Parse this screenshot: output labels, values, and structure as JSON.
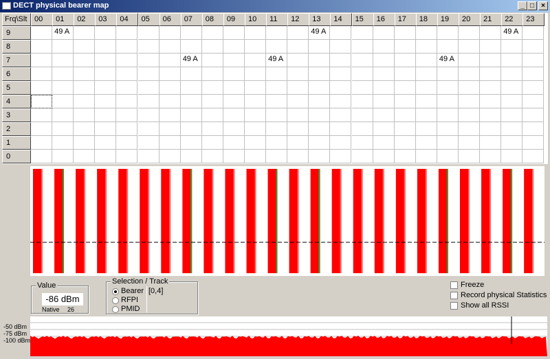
{
  "window": {
    "title": "DECT physical bearer map",
    "buttons": {
      "minimize": "_",
      "maximize": "□",
      "close": "×"
    }
  },
  "map": {
    "corner": "Frq\\Slt",
    "slots": [
      "00",
      "01",
      "02",
      "03",
      "04",
      "05",
      "06",
      "07",
      "08",
      "09",
      "10",
      "11",
      "12",
      "13",
      "14",
      "15",
      "16",
      "17",
      "18",
      "19",
      "20",
      "21",
      "22",
      "23"
    ],
    "freqs": [
      "9",
      "8",
      "7",
      "6",
      "5",
      "4",
      "3",
      "2",
      "1",
      "0"
    ],
    "bearers": [
      {
        "freq": "9",
        "slot": "01",
        "text": "49 A"
      },
      {
        "freq": "9",
        "slot": "13",
        "text": "49 A"
      },
      {
        "freq": "9",
        "slot": "22",
        "text": "49 A"
      },
      {
        "freq": "7",
        "slot": "07",
        "text": "49 A"
      },
      {
        "freq": "7",
        "slot": "11",
        "text": "49 A"
      },
      {
        "freq": "7",
        "slot": "19",
        "text": "49 A"
      }
    ],
    "selected": {
      "freq": "4",
      "slot": "00"
    }
  },
  "waveform": {
    "bar_color": "#ff0000",
    "active_color": "#008000",
    "active_slots": [
      "01",
      "07",
      "11",
      "13",
      "19",
      "22"
    ]
  },
  "value_box": {
    "legend": "Value",
    "value": "-86 dBm",
    "native_label": "Native",
    "native_value": "26"
  },
  "selection": {
    "legend": "Selection / Track",
    "options": [
      "Bearer",
      "RFPI",
      "PMID"
    ],
    "selected": "Bearer",
    "track": "[0,4]"
  },
  "options": [
    {
      "label": "Freeze",
      "checked": false
    },
    {
      "label": "Record physical Statistics",
      "checked": false
    },
    {
      "label": "Show all RSSI",
      "checked": false
    }
  ],
  "rssi": {
    "labels": [
      "-50 dBm",
      "-75 dBm",
      "-100 dBm"
    ],
    "color": "#ff0000"
  }
}
